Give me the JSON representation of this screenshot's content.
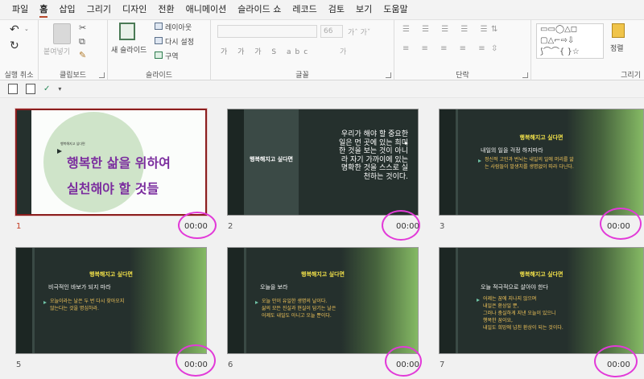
{
  "menu": [
    "파일",
    "홈",
    "삽입",
    "그리기",
    "디자인",
    "전환",
    "애니메이션",
    "슬라이드 쇼",
    "레코드",
    "검토",
    "보기",
    "도움말"
  ],
  "active_menu": "홈",
  "ribbon": {
    "undo_label": "실행 취소",
    "clipboard": {
      "paste": "붙여넣기",
      "label": "클립보드"
    },
    "slides": {
      "new_slide": "새 슬라이드",
      "layout": "레이아웃",
      "reset": "다시 설정",
      "section": "구역",
      "label": "슬라이드"
    },
    "font": {
      "size": "66",
      "label": "글꼴"
    },
    "paragraph": {
      "label": "단락"
    },
    "drawing": {
      "arrange": "정렬",
      "label": "그리기"
    }
  },
  "slides": [
    {
      "num": "1",
      "time": "00:00",
      "small": "행복해지고 싶다면",
      "line1": "행복한 삶을 위하여",
      "line2": "실천해야 할 것들"
    },
    {
      "num": "2",
      "time": "00:00",
      "left": "행복해지고 싶다면",
      "body": [
        "우리가 해야 할 중요한",
        "일은 먼 곳에 있는 희미",
        "한 것을 보는 것이 아니",
        "라 자기 가까이에 있는",
        "명확한 것을 스스로 실",
        "천하는 것이다."
      ]
    },
    {
      "num": "3",
      "time": "00:00",
      "title": "행복해지고 싶다면",
      "sub": "내일의 일을 걱정 하지마라",
      "body": [
        "정신적 고민과 번뇌는 내일의 일에 머리를 앓",
        "는 사람들이 발생치를 생명없이 따라 다닌다."
      ]
    },
    {
      "num": "5",
      "time": "00:00",
      "title": "행복해지고 싶다면",
      "sub": "비극적인 바보가 되지 마라",
      "body": [
        "오늘이라는 날은 두 번 다시 찾아오지",
        "않는다는 것을 명심하라."
      ]
    },
    {
      "num": "6",
      "time": "00:00",
      "title": "행복해지고 싶다면",
      "sub": "오늘을 보라",
      "body": [
        "오늘 만이 유일한 생명의 날이다.",
        "삶의 모든 진실과 현실이 담기는 날은",
        "어제도 내일도 아니고 오늘 뿐이다."
      ]
    },
    {
      "num": "7",
      "time": "00:00",
      "title": "행복해지고 싶다면",
      "sub": "오늘 적극적으로 살아야 한다",
      "body": [
        "어제는 꿈에 지나지 않으며",
        "내일은 환상일 뿐,",
        "그러나 충실하게 지낸 오늘이 있으니",
        "행복한 꿈이요,",
        "내일도 희망에 넘친 환상이 되는 것이다."
      ]
    }
  ],
  "colors": {
    "accent": "#b7472a",
    "annotation": "#e23ad8",
    "slide_bg": "#25302d",
    "title_yellow": "#f2e14a",
    "selected_border": "#8b1e1e"
  }
}
